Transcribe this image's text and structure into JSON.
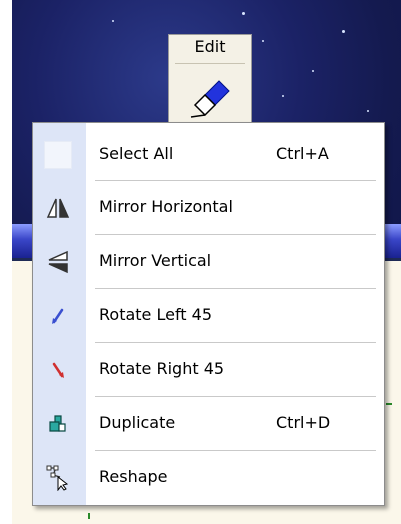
{
  "toolbar": {
    "edit_label": "Edit",
    "edit_icon": "eraser-icon"
  },
  "menu": {
    "items": [
      {
        "label": "Select All",
        "shortcut": "Ctrl+A",
        "icon": "blank-icon"
      },
      {
        "label": "Mirror Horizontal",
        "shortcut": "",
        "icon": "mirror-horizontal-icon"
      },
      {
        "label": "Mirror Vertical",
        "shortcut": "",
        "icon": "mirror-vertical-icon"
      },
      {
        "label": "Rotate Left 45",
        "shortcut": "",
        "icon": "rotate-left-icon"
      },
      {
        "label": "Rotate Right 45",
        "shortcut": "",
        "icon": "rotate-right-icon"
      },
      {
        "label": "Duplicate",
        "shortcut": "Ctrl+D",
        "icon": "duplicate-icon"
      },
      {
        "label": "Reshape",
        "shortcut": "",
        "icon": "reshape-icon"
      }
    ]
  },
  "colors": {
    "menu_gutter": "#dde5f7",
    "menu_border": "#8c8c8c",
    "rotate_left": "#3a4fd0",
    "rotate_right": "#d03030",
    "duplicate": "#2aa8a0"
  }
}
